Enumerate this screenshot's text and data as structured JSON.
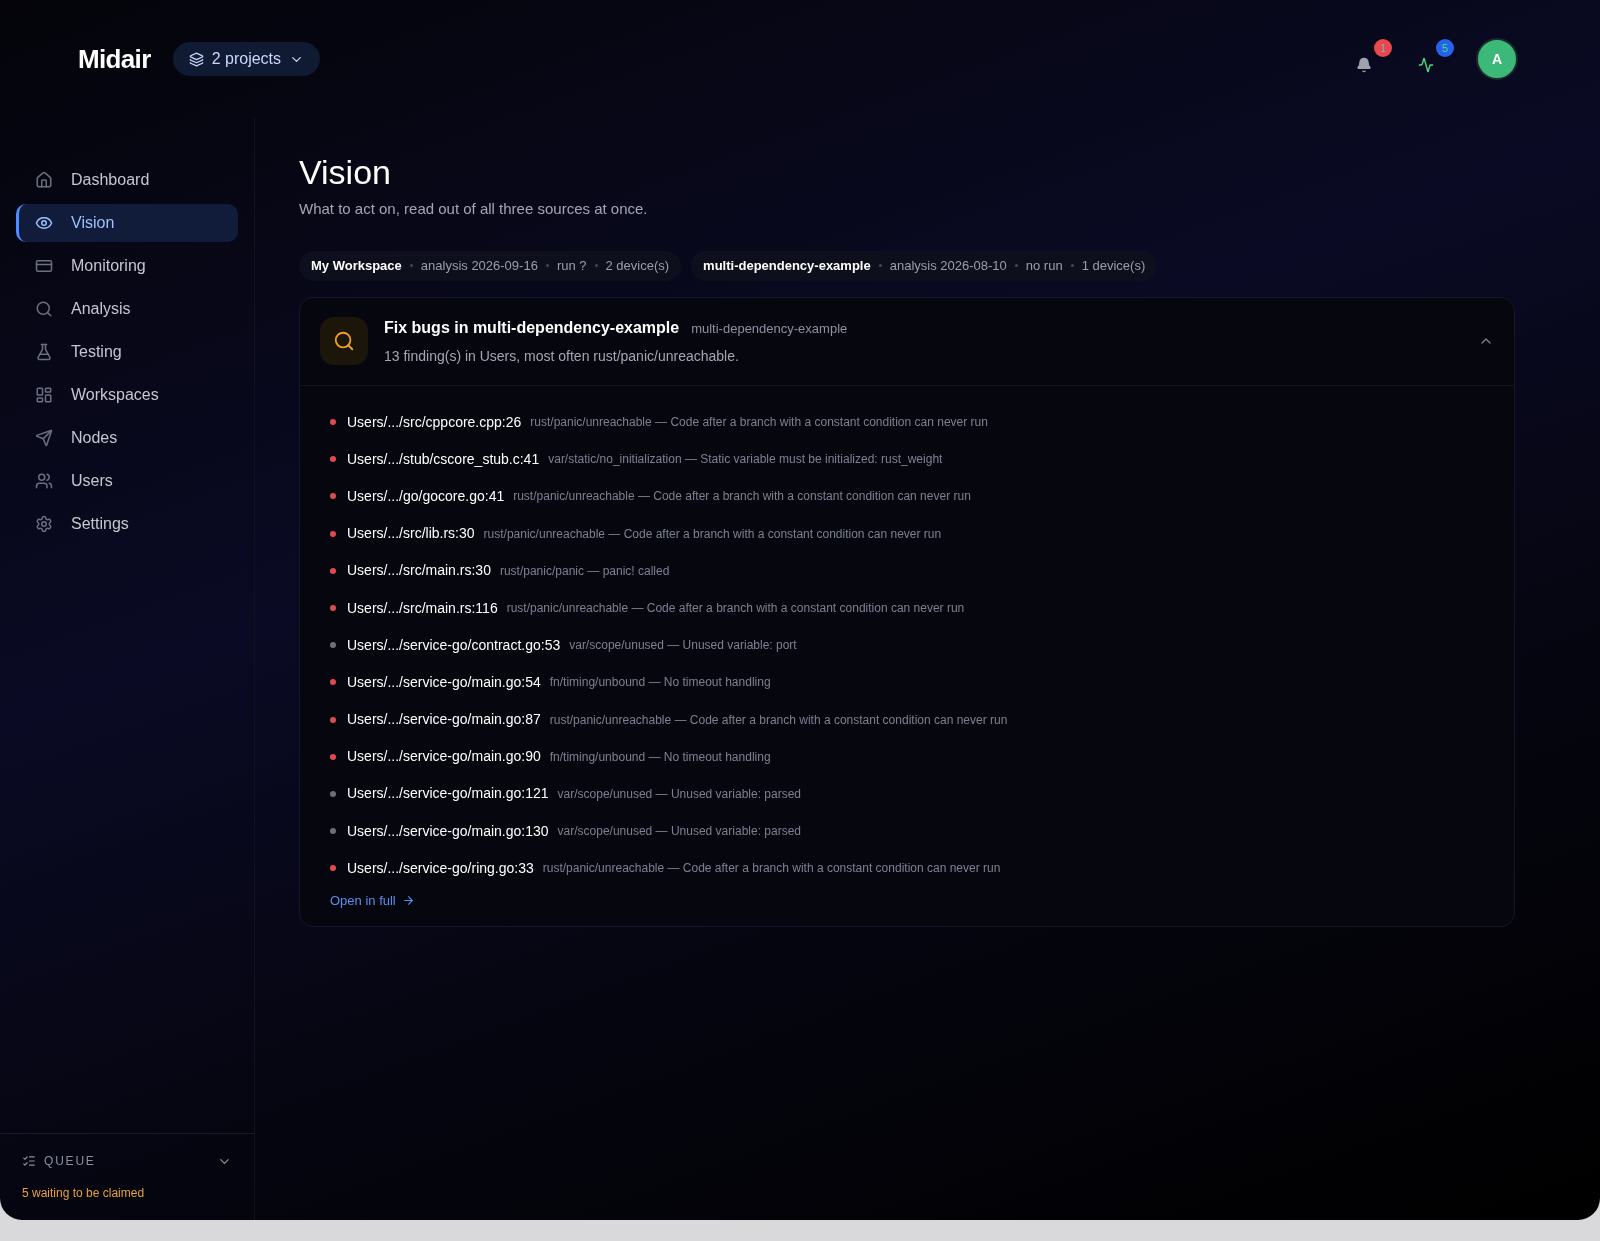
{
  "brand": "Midair",
  "project_switcher": {
    "label": "2 projects"
  },
  "header": {
    "notifications_badge": "1",
    "activity_badge": "5",
    "avatar": "A"
  },
  "sidebar": {
    "items": [
      {
        "label": "Dashboard",
        "selected": false
      },
      {
        "label": "Vision",
        "selected": true
      },
      {
        "label": "Monitoring",
        "selected": false
      },
      {
        "label": "Analysis",
        "selected": false
      },
      {
        "label": "Testing",
        "selected": false
      },
      {
        "label": "Workspaces",
        "selected": false
      },
      {
        "label": "Nodes",
        "selected": false
      },
      {
        "label": "Users",
        "selected": false
      },
      {
        "label": "Settings",
        "selected": false
      }
    ],
    "queue": {
      "title": "QUEUE",
      "status": "5 waiting to be claimed",
      "expanded": false
    }
  },
  "page": {
    "title": "Vision",
    "subtitle": "What to act on, read out of all three sources at once."
  },
  "sources": [
    {
      "name": "My Workspace",
      "parts": [
        "analysis 2026-09-16",
        "run ?",
        "2 device(s)"
      ]
    },
    {
      "name": "multi-dependency-example",
      "parts": [
        "analysis 2026-08-10",
        "no run",
        "1 device(s)"
      ]
    }
  ],
  "card": {
    "title": "Fix bugs in multi-dependency-example",
    "tag": "multi-dependency-example",
    "summary": "13 finding(s) in Users, most often rust/panic/unreachable.",
    "expanded": true,
    "findings": [
      {
        "location": "Users/.../src/cppcore.cpp:26",
        "detail": "rust/panic/unreachable — Code after a branch with a constant condition can never run",
        "color": "#e5484d"
      },
      {
        "location": "Users/.../stub/cscore_stub.c:41",
        "detail": "var/static/no_initialization — Static variable must be initialized: rust_weight",
        "color": "#e5484d"
      },
      {
        "location": "Users/.../go/gocore.go:41",
        "detail": "rust/panic/unreachable — Code after a branch with a constant condition can never run",
        "color": "#e5484d"
      },
      {
        "location": "Users/.../src/lib.rs:30",
        "detail": "rust/panic/unreachable — Code after a branch with a constant condition can never run",
        "color": "#e5484d"
      },
      {
        "location": "Users/.../src/main.rs:30",
        "detail": "rust/panic/panic — panic! called",
        "color": "#e5484d"
      },
      {
        "location": "Users/.../src/main.rs:116",
        "detail": "rust/panic/unreachable — Code after a branch with a constant condition can never run",
        "color": "#e5484d"
      },
      {
        "location": "Users/.../service-go/contract.go:53",
        "detail": "var/scope/unused — Unused variable: port",
        "color": "#6b6f7a"
      },
      {
        "location": "Users/.../service-go/main.go:54",
        "detail": "fn/timing/unbound — No timeout handling",
        "color": "#e5484d"
      },
      {
        "location": "Users/.../service-go/main.go:87",
        "detail": "rust/panic/unreachable — Code after a branch with a constant condition can never run",
        "color": "#e5484d"
      },
      {
        "location": "Users/.../service-go/main.go:90",
        "detail": "fn/timing/unbound — No timeout handling",
        "color": "#e5484d"
      },
      {
        "location": "Users/.../service-go/main.go:121",
        "detail": "var/scope/unused — Unused variable: parsed",
        "color": "#6b6f7a"
      },
      {
        "location": "Users/.../service-go/main.go:130",
        "detail": "var/scope/unused — Unused variable: parsed",
        "color": "#6b6f7a"
      },
      {
        "location": "Users/.../service-go/ring.go:33",
        "detail": "rust/panic/unreachable — Code after a branch with a constant condition can never run",
        "color": "#e5484d"
      }
    ],
    "link": "Open in full"
  }
}
